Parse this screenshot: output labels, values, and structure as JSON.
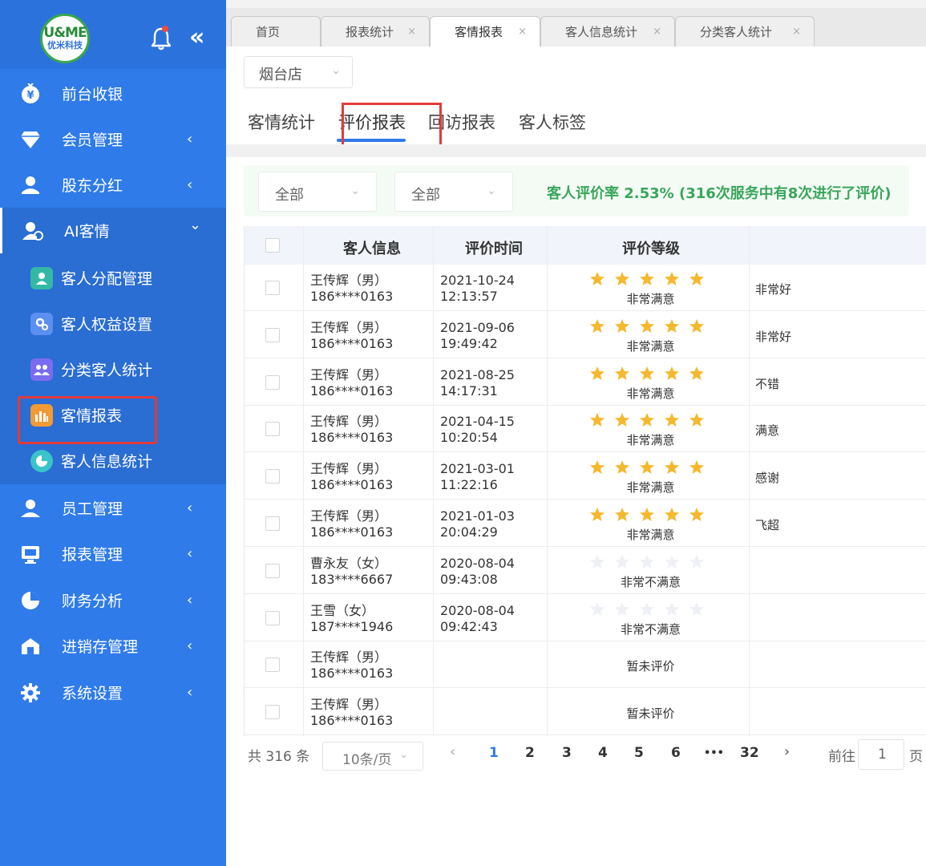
{
  "sidebar": {
    "logo": {
      "line1": "U&ME",
      "line2": "优米科技"
    },
    "items": [
      {
        "label": "前台收银",
        "icon": "yen-icon"
      },
      {
        "label": "会员管理",
        "icon": "diamond-icon",
        "chevron": "‹"
      },
      {
        "label": "股东分红",
        "icon": "shareholder-icon",
        "chevron": "‹"
      },
      {
        "label": "AI客情",
        "icon": "ai-user-icon",
        "chevron": "⌄"
      },
      {
        "label": "员工管理",
        "icon": "staff-icon",
        "chevron": "‹"
      },
      {
        "label": "报表管理",
        "icon": "report-icon",
        "chevron": "‹"
      },
      {
        "label": "财务分析",
        "icon": "pie-icon",
        "chevron": "‹"
      },
      {
        "label": "进销存管理",
        "icon": "warehouse-icon",
        "chevron": "‹"
      },
      {
        "label": "系统设置",
        "icon": "gear-icon",
        "chevron": "‹"
      }
    ],
    "submenu": [
      {
        "label": "客人分配管理",
        "color": "#34b8a6"
      },
      {
        "label": "客人权益设置",
        "color": "#5b8ff0"
      },
      {
        "label": "分类客人统计",
        "color": "#7a6cf0"
      },
      {
        "label": "客情报表",
        "color": "#f29a35"
      },
      {
        "label": "客人信息统计",
        "color": "#3ac3c9"
      }
    ]
  },
  "tabs": [
    {
      "label": "首页",
      "close": ""
    },
    {
      "label": "报表统计",
      "close": "×"
    },
    {
      "label": "客情报表",
      "close": "×"
    },
    {
      "label": "客人信息统计",
      "close": "×"
    },
    {
      "label": "分类客人统计",
      "close": "×"
    }
  ],
  "store": {
    "value": "烟台店"
  },
  "subtabs": [
    "客情统计",
    "评价报表",
    "回访报表",
    "客人标签"
  ],
  "filters": [
    {
      "value": "全部"
    },
    {
      "value": "全部"
    }
  ],
  "rate_text": "客人评价率 2.53%  (316次服务中有8次进行了评价)",
  "table": {
    "headers": [
      "客人信息",
      "评价时间",
      "评价等级"
    ],
    "rows": [
      {
        "name": "王传辉（男）",
        "phone": "186****0163",
        "date": "2021-10-24",
        "time": "12:13:57",
        "stars": 5,
        "rating": "非常满意",
        "comment": "非常好"
      },
      {
        "name": "王传辉（男）",
        "phone": "186****0163",
        "date": "2021-09-06",
        "time": "19:49:42",
        "stars": 5,
        "rating": "非常满意",
        "comment": "非常好"
      },
      {
        "name": "王传辉（男）",
        "phone": "186****0163",
        "date": "2021-08-25",
        "time": "14:17:31",
        "stars": 5,
        "rating": "非常满意",
        "comment": "不错"
      },
      {
        "name": "王传辉（男）",
        "phone": "186****0163",
        "date": "2021-04-15",
        "time": "10:20:54",
        "stars": 5,
        "rating": "非常满意",
        "comment": "满意"
      },
      {
        "name": "王传辉（男）",
        "phone": "186****0163",
        "date": "2021-03-01",
        "time": "11:22:16",
        "stars": 5,
        "rating": "非常满意",
        "comment": "感谢"
      },
      {
        "name": "王传辉（男）",
        "phone": "186****0163",
        "date": "2021-01-03",
        "time": "20:04:29",
        "stars": 5,
        "rating": "非常满意",
        "comment": "飞超"
      },
      {
        "name": "曹永友（女）",
        "phone": "183****6667",
        "date": "2020-08-04",
        "time": "09:43:08",
        "stars": 0,
        "rating": "非常不满意",
        "comment": ""
      },
      {
        "name": "王雪（女）",
        "phone": "187****1946",
        "date": "2020-08-04",
        "time": "09:42:43",
        "stars": 0,
        "rating": "非常不满意",
        "comment": ""
      },
      {
        "name": "王传辉（男）",
        "phone": "186****0163",
        "date": "",
        "time": "",
        "stars": -1,
        "rating": "暂未评价",
        "comment": ""
      },
      {
        "name": "王传辉（男）",
        "phone": "186****0163",
        "date": "",
        "time": "",
        "stars": -1,
        "rating": "暂未评价",
        "comment": ""
      }
    ]
  },
  "pagination": {
    "total": "共 316 条",
    "page_size": "10条/页",
    "prev": "‹",
    "pages": [
      "1",
      "2",
      "3",
      "4",
      "5",
      "6",
      "•••",
      "32"
    ],
    "current": "1",
    "next": "›",
    "goto_label": "前往",
    "goto_value": "1",
    "page_label": "页"
  },
  "colors": {
    "sidebar": "#2f7bea",
    "accent": "#2f7bea",
    "star": "#f5b82e",
    "rate": "#3aa65a",
    "highlight": "#e33a3a"
  }
}
